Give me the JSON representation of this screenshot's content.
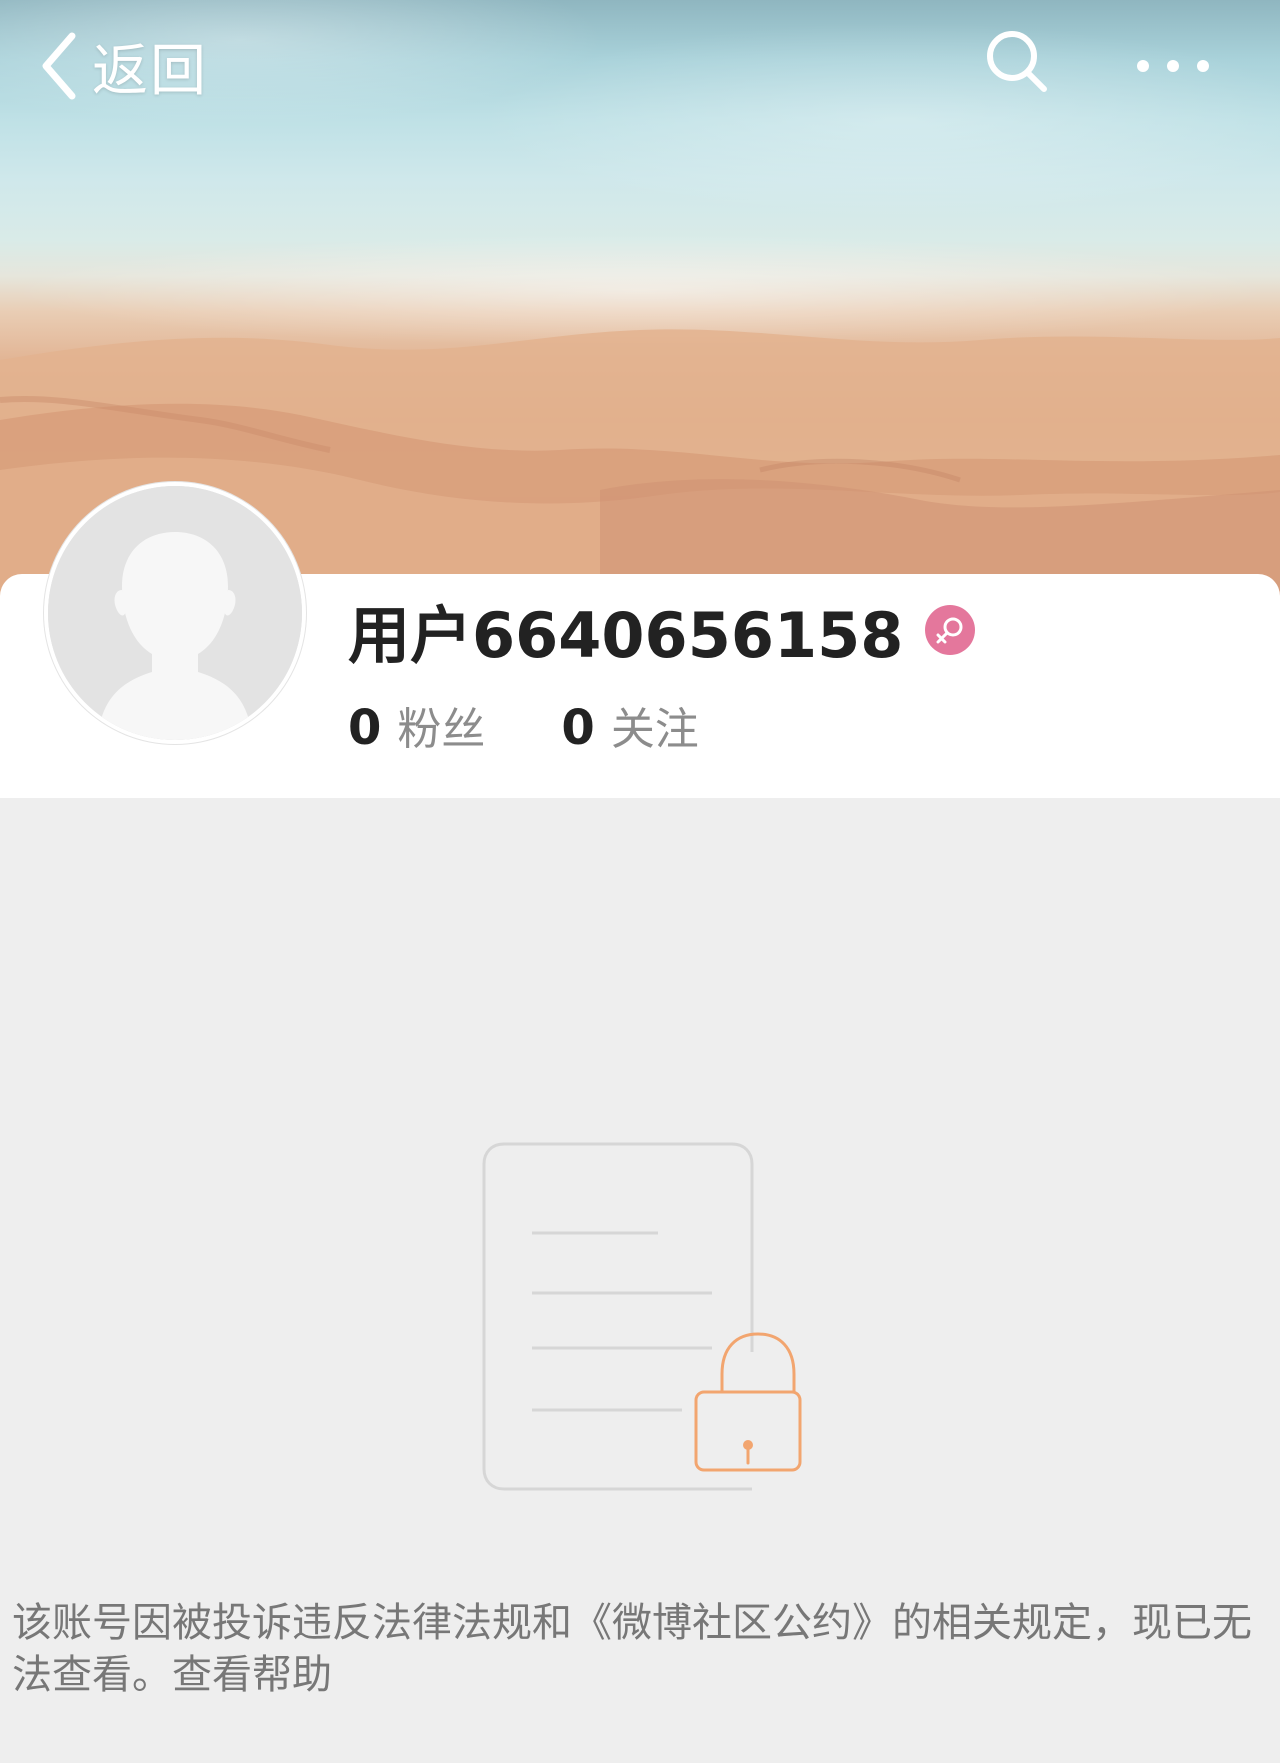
{
  "header": {
    "back_label": "返回",
    "icons": [
      "chevron-left-icon",
      "search-icon",
      "more-icon"
    ]
  },
  "profile": {
    "username": "用户6640656158",
    "gender_icon": "female-icon",
    "gender_color": "#e4779c",
    "fans_count": "0",
    "fans_label": "粉丝",
    "following_count": "0",
    "following_label": "关注"
  },
  "blocked": {
    "illustration_icon": "locked-document-icon",
    "accent_color": "#f2a56f",
    "message_text": "该账号因被投诉违反法律法规和《微博社区公约》的相关规定，现已无法查看。",
    "help_link": "查看帮助"
  }
}
